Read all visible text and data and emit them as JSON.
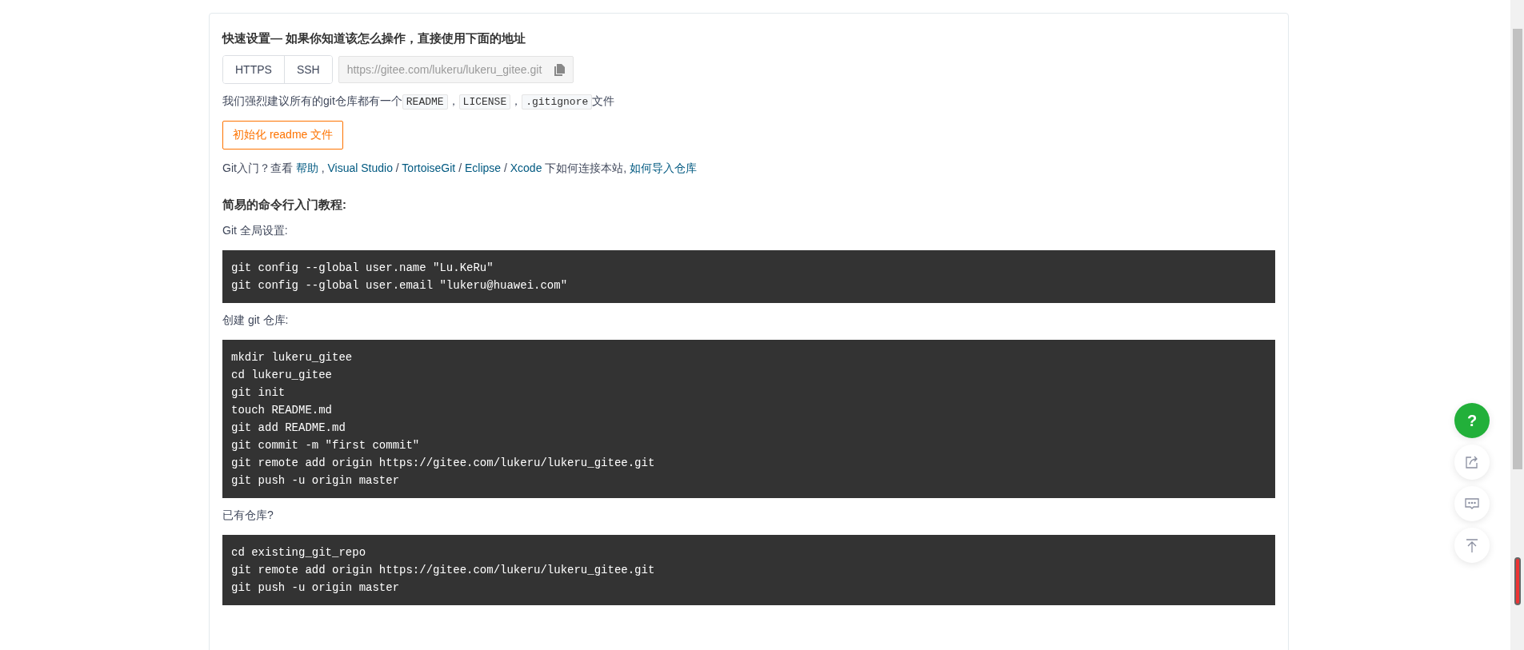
{
  "quick_setup": {
    "title": "快速设置— 如果你知道该怎么操作，直接使用下面的地址",
    "protocols": [
      {
        "label": "HTTPS",
        "selected": false
      },
      {
        "label": "SSH",
        "selected": false
      }
    ],
    "url_field": {
      "value": "https://gitee.com/lukeru/lukeru_gitee.git"
    },
    "recommendation": [
      {
        "kind": "text",
        "text": "我们强烈建议所有的git仓库都有一个"
      },
      {
        "kind": "code",
        "text": "README"
      },
      {
        "kind": "text",
        "text": "，"
      },
      {
        "kind": "code",
        "text": "LICENSE"
      },
      {
        "kind": "text",
        "text": "，"
      },
      {
        "kind": "code",
        "text": ".gitignore"
      },
      {
        "kind": "text",
        "text": "文件"
      }
    ],
    "init_button": "初始化 readme 文件",
    "help_line": [
      {
        "kind": "text",
        "text": "Git入门？查看 "
      },
      {
        "kind": "link",
        "text": "帮助"
      },
      {
        "kind": "text",
        "text": " , "
      },
      {
        "kind": "link",
        "text": "Visual Studio"
      },
      {
        "kind": "text",
        "text": " / "
      },
      {
        "kind": "link",
        "text": "TortoiseGit"
      },
      {
        "kind": "text",
        "text": " / "
      },
      {
        "kind": "link",
        "text": "Eclipse"
      },
      {
        "kind": "text",
        "text": " / "
      },
      {
        "kind": "link",
        "text": "Xcode"
      },
      {
        "kind": "text",
        "text": " 下如何连接本站, "
      },
      {
        "kind": "link",
        "text": "如何导入仓库"
      }
    ]
  },
  "tutorial": {
    "title": "简易的命令行入门教程:",
    "sections": [
      {
        "label": "Git 全局设置:",
        "code": [
          "git config --global user.name \"Lu.KeRu\"",
          "git config --global user.email \"lukeru@huawei.com\""
        ]
      },
      {
        "label": "创建 git 仓库:",
        "code": [
          "mkdir lukeru_gitee",
          "cd lukeru_gitee",
          "git init",
          "touch README.md",
          "git add README.md",
          "git commit -m \"first commit\"",
          "git remote add origin https://gitee.com/lukeru/lukeru_gitee.git",
          "git push -u origin master"
        ]
      },
      {
        "label": "已有仓库?",
        "code": [
          "cd existing_git_repo",
          "git remote add origin https://gitee.com/lukeru/lukeru_gitee.git",
          "git push -u origin master"
        ]
      }
    ]
  },
  "float_tools": {
    "help_label": "?"
  }
}
